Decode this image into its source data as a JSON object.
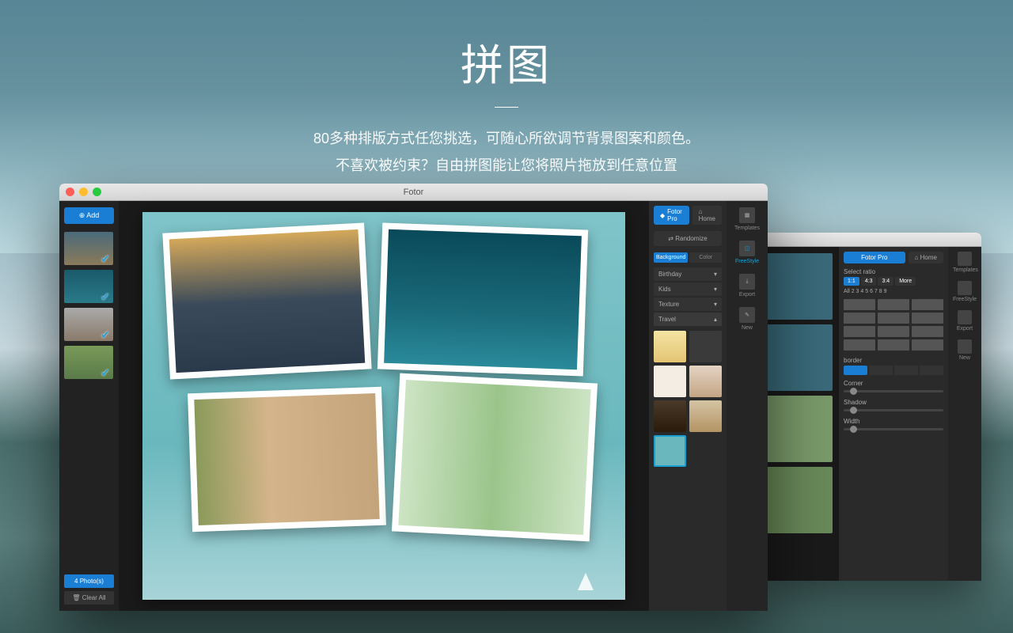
{
  "hero": {
    "title": "拼图",
    "line1": "80多种排版方式任您挑选，可随心所欲调节背景图案和颜色。",
    "line2": "不喜欢被约束？自由拼图能让您将照片拖放到任意位置"
  },
  "window": {
    "title": "Fotor",
    "add_button": "⊕ Add",
    "photo_count": "4 Photo(s)",
    "clear_all": "🗑 Clear All",
    "pro_label": "Fotor Pro",
    "home_label": "⌂ Home",
    "randomize": "⇄ Randomize",
    "tabs": {
      "background": "Background",
      "color": "Color"
    },
    "categories": [
      "Birthday",
      "Kids",
      "Texture",
      "Travel"
    ],
    "tools": {
      "templates": "Templates",
      "freestyle": "FreeStyle",
      "export": "Export",
      "new": "New"
    }
  },
  "back_window": {
    "pro_label": "Fotor Pro",
    "home_label": "⌂ Home",
    "select_ratio": "Select ratio",
    "ratios": [
      "1:1",
      "4:3",
      "3:4",
      "More"
    ],
    "grid_nums": "All 2 3 4 5 6 7 8 9",
    "border_label": "border",
    "corner_label": "Corner",
    "shadow_label": "Shadow",
    "width_label": "Width",
    "tools": {
      "templates": "Templates",
      "freestyle": "FreeStyle",
      "export": "Export",
      "new": "New"
    }
  }
}
